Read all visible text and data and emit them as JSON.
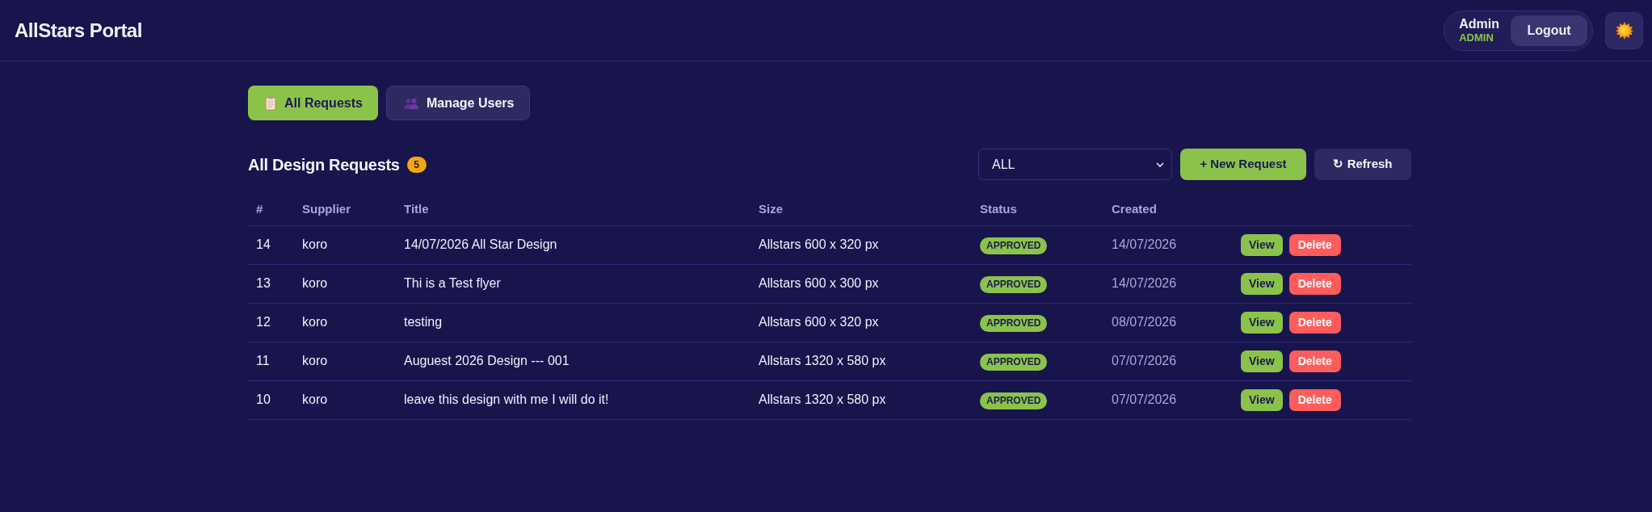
{
  "header": {
    "title": "AllStars Portal",
    "user": {
      "name": "Admin",
      "role": "ADMIN"
    },
    "logout_button": "Logout"
  },
  "tabs": [
    {
      "label": "All Requests",
      "kind": "requests",
      "selected": true
    },
    {
      "label": "Manage Users",
      "kind": "users",
      "selected": false
    }
  ],
  "section": {
    "title": "All Design Requests",
    "count": "5",
    "filter": {
      "value": "ALL"
    },
    "buttons": [
      {
        "label": "+ New Request",
        "kind": "primary"
      },
      {
        "label": "↻ Refresh",
        "kind": "secondary"
      }
    ]
  },
  "table": {
    "columns": [
      "#",
      "Supplier",
      "Title",
      "Size",
      "Status",
      "Created"
    ],
    "rows": [
      {
        "id": "14",
        "supplier": "koro",
        "title": "14/07/2026 All Star Design",
        "size": "Allstars 600 x 320 px",
        "status": "APPROVED",
        "created": "14/07/2026",
        "actions": [
          {
            "label": "View",
            "kind": "view"
          },
          {
            "label": "Delete",
            "kind": "delete"
          }
        ]
      },
      {
        "id": "13",
        "supplier": "koro",
        "title": "Thi is a Test flyer",
        "size": "Allstars 600 x 300 px",
        "status": "APPROVED",
        "created": "14/07/2026",
        "actions": [
          {
            "label": "View",
            "kind": "view"
          },
          {
            "label": "Delete",
            "kind": "delete"
          }
        ]
      },
      {
        "id": "12",
        "supplier": "koro",
        "title": "testing",
        "size": "Allstars 600 x 320 px",
        "status": "APPROVED",
        "created": "08/07/2026",
        "actions": [
          {
            "label": "View",
            "kind": "view"
          },
          {
            "label": "Delete",
            "kind": "delete"
          }
        ]
      },
      {
        "id": "11",
        "supplier": "koro",
        "title": "Auguest 2026 Design --- 001",
        "size": "Allstars 1320 x 580 px",
        "status": "APPROVED",
        "created": "07/07/2026",
        "actions": [
          {
            "label": "View",
            "kind": "view"
          },
          {
            "label": "Delete",
            "kind": "delete"
          }
        ]
      },
      {
        "id": "10",
        "supplier": "koro",
        "title": "leave this design with me I will do it!",
        "size": "Allstars 1320 x 580 px",
        "status": "APPROVED",
        "created": "07/07/2026",
        "actions": [
          {
            "label": "View",
            "kind": "view"
          },
          {
            "label": "Delete",
            "kind": "delete"
          }
        ]
      }
    ]
  }
}
